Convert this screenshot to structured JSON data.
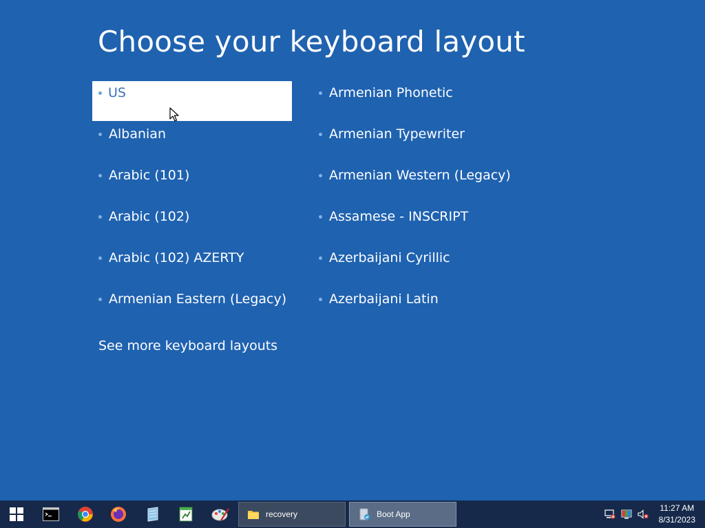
{
  "title": "Choose your keyboard layout",
  "layouts_left": [
    {
      "label": "US",
      "selected": true
    },
    {
      "label": "Albanian"
    },
    {
      "label": "Arabic (101)"
    },
    {
      "label": "Arabic (102)"
    },
    {
      "label": "Arabic (102) AZERTY"
    },
    {
      "label": "Armenian Eastern (Legacy)"
    }
  ],
  "layouts_right": [
    {
      "label": "Armenian Phonetic"
    },
    {
      "label": "Armenian Typewriter"
    },
    {
      "label": "Armenian Western (Legacy)"
    },
    {
      "label": "Assamese - INSCRIPT"
    },
    {
      "label": "Azerbaijani Cyrillic"
    },
    {
      "label": "Azerbaijani Latin"
    }
  ],
  "see_more": "See more keyboard layouts",
  "taskbar": {
    "pinned": [
      {
        "icon": "windows-start-icon"
      },
      {
        "icon": "command-prompt-icon"
      },
      {
        "icon": "chrome-icon"
      },
      {
        "icon": "firefox-icon"
      },
      {
        "icon": "notepad-icon"
      },
      {
        "icon": "spreadsheet-icon"
      },
      {
        "icon": "paint-icon"
      }
    ],
    "tasks": [
      {
        "label": "recovery",
        "icon": "folder-icon"
      },
      {
        "label": "Boot App",
        "icon": "boot-app-icon",
        "active": true
      }
    ],
    "tray_icons": [
      "network-error-icon",
      "color-display-icon",
      "volume-muted-icon"
    ],
    "clock": {
      "time": "11:27 AM",
      "date": "8/31/2023"
    }
  },
  "colors": {
    "background": "#1f62b0",
    "selected": "#ffffff",
    "taskbar": "#16294a"
  }
}
